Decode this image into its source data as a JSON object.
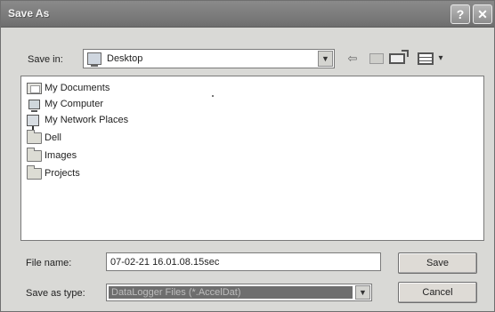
{
  "window": {
    "title": "Save As"
  },
  "title_buttons": {
    "help": "?",
    "close": "✕"
  },
  "toolbar": {
    "save_in_label": "Save in:",
    "save_in_value": "Desktop",
    "dropdown_glyph": "▼",
    "back_glyph": "⇦",
    "views_arrow_glyph": "▾"
  },
  "files": [
    {
      "name": "My Documents",
      "icon": "my-documents-icon"
    },
    {
      "name": "My Computer",
      "icon": "computer-icon"
    },
    {
      "name": "My Network Places",
      "icon": "network-places-icon"
    },
    {
      "name": "Dell",
      "icon": "folder-icon"
    },
    {
      "name": "Images",
      "icon": "folder-icon"
    },
    {
      "name": "Projects",
      "icon": "folder-icon"
    }
  ],
  "form": {
    "file_name_label": "File name:",
    "file_name_value": "07-02-21 16.01.08.15sec",
    "save_as_type_label": "Save as type:",
    "save_as_type_value": "DataLogger Files (*.AccelDat)"
  },
  "buttons": {
    "save": "Save",
    "cancel": "Cancel"
  }
}
